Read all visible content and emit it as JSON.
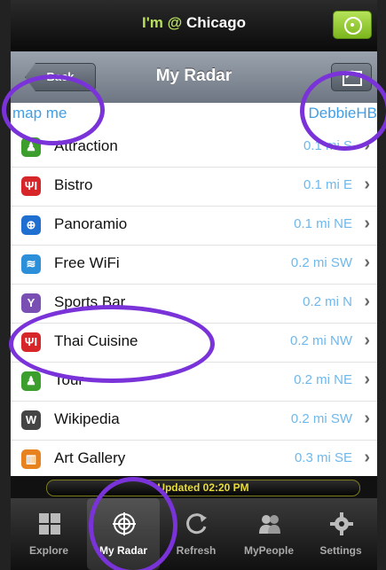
{
  "location_bar": {
    "prefix": "I'm",
    "at": "@",
    "city": "Chicago",
    "locate_icon": "crosshair-icon"
  },
  "nav": {
    "back_label": "Back",
    "title": "My Radar",
    "share_icon": "share-icon"
  },
  "header": {
    "map_me": "map me",
    "user": "DebbieHB"
  },
  "places": [
    {
      "name": "Attraction",
      "distance": "0.1 mi S",
      "icon": "attraction-icon",
      "color": "#3c9e2c",
      "glyph": "♟"
    },
    {
      "name": "Bistro",
      "distance": "0.1 mi E",
      "icon": "fork-knife-icon",
      "color": "#d6262a",
      "glyph": "ΨΙ"
    },
    {
      "name": "Panoramio",
      "distance": "0.1 mi NE",
      "icon": "panoramio-icon",
      "color": "#1f6fd0",
      "glyph": "⊕"
    },
    {
      "name": "Free WiFi",
      "distance": "0.2 mi SW",
      "icon": "wifi-icon",
      "color": "#2c8fd9",
      "glyph": "≋"
    },
    {
      "name": "Sports Bar",
      "distance": "0.2 mi N",
      "icon": "drink-icon",
      "color": "#7a4fb4",
      "glyph": "Y"
    },
    {
      "name": "Thai Cuisine",
      "distance": "0.2 mi NW",
      "icon": "fork-knife-icon",
      "color": "#d6262a",
      "glyph": "ΨΙ"
    },
    {
      "name": "Tour",
      "distance": "0.2 mi NE",
      "icon": "tour-icon",
      "color": "#3c9e2c",
      "glyph": "♟"
    },
    {
      "name": "Wikipedia",
      "distance": "0.2 mi SW",
      "icon": "wikipedia-icon",
      "color": "#444444",
      "glyph": "W"
    },
    {
      "name": "Art Gallery",
      "distance": "0.3 mi SE",
      "icon": "gallery-icon",
      "color": "#e8821e",
      "glyph": "▥"
    }
  ],
  "updated": "Updated 02:20 PM",
  "tabs": [
    {
      "label": "Explore",
      "icon": "explore-grid-icon"
    },
    {
      "label": "My Radar",
      "icon": "radar-icon"
    },
    {
      "label": "Refresh",
      "icon": "refresh-icon"
    },
    {
      "label": "MyPeople",
      "icon": "people-icon"
    },
    {
      "label": "Settings",
      "icon": "gear-icon"
    }
  ],
  "colors": {
    "accent_link": "#3e9fe8",
    "annotation": "#7a33d9",
    "status_green": "#b8e060"
  }
}
